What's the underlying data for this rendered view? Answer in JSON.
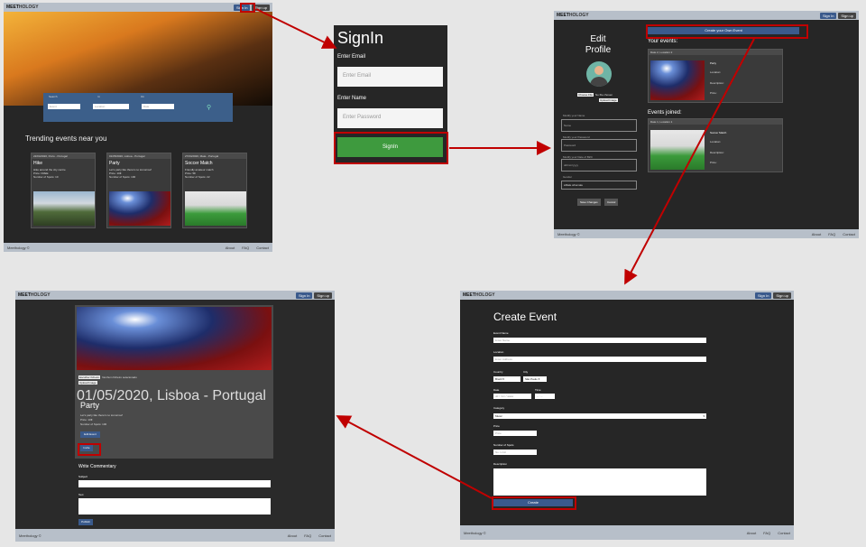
{
  "brand": {
    "logo_bold": "MEET",
    "logo_rest": "HOLOGY"
  },
  "nav": {
    "signin": "Sign In",
    "signup": "Sign up"
  },
  "footer": {
    "brand": "Meethology ©",
    "about": "About",
    "faq": "FAQ",
    "contact": "Contact"
  },
  "home": {
    "search_labels": [
      "Search",
      "In",
      "On"
    ],
    "search_placeholders": [
      "Event",
      "Location",
      "Date"
    ],
    "section_title": "Trending events near you",
    "cards": [
      {
        "date": "22/04/2020, Porto - Portugal",
        "title": "Hike",
        "desc": "Hike around the city centre",
        "price": "Price: FREE",
        "spots": "Number of Spots: 10"
      },
      {
        "date": "01/05/2020, Lisboa - Portugal",
        "title": "Party",
        "desc": "Let's party like there's no tomorrow!",
        "price": "Price: 10€",
        "spots": "Number of Spots: 100"
      },
      {
        "date": "27/04/2020, Maia - Portugal",
        "title": "Soccer Match",
        "desc": "Friendly amateur match",
        "price": "Price: 5€",
        "spots": "Number of Spots: 22"
      }
    ]
  },
  "signin": {
    "title": "SignIn",
    "email_label": "Enter Email",
    "email_placeholder": "Enter Email",
    "name_label": "Enter Name",
    "password_placeholder": "Enter Password",
    "button": "SignIn"
  },
  "profile": {
    "title_line1": "Edit",
    "title_line2": "Profile",
    "choose_file": "Choose File",
    "no_file": "No file chosen",
    "upload": "Upload Image",
    "fields": [
      {
        "label": "Modify your Name",
        "placeholder": "Name"
      },
      {
        "label": "Modify your Password",
        "placeholder": "Password"
      },
      {
        "label": "Modify your Date of Birth",
        "placeholder": "dd/mm/yyyy"
      }
    ],
    "gender_label": "Gender",
    "male": "Male",
    "female": "Female",
    "save": "Save Changes",
    "cancel": "Cancel",
    "create_button": "Create your Own Event",
    "your_events": "Your events:",
    "events_joined": "Events joined:",
    "event_header": "Date 1, Location 1",
    "event_header2": "Date 2, Location 2",
    "event_title": "Party",
    "event_title2": "Soccer Match",
    "fields_right": [
      "Location:",
      "Description:",
      "Price:"
    ]
  },
  "create": {
    "title": "Create Event",
    "event_name_label": "Event Name",
    "event_name_ph": "Enter Name",
    "location_label": "Location",
    "location_ph": "Enter Address",
    "country_label": "Country",
    "country_val": "Brazil",
    "city_label": "City",
    "city_val": "São Paulo",
    "date_label": "Date",
    "date_ph": "dd / mm / aaaa",
    "time_label": "Time",
    "time_ph": "-- : --",
    "category_label": "Category",
    "category_val": "Music",
    "price_label": "Price",
    "price_ph": "Price",
    "spots_label": "Number of Spots",
    "spots_ph": "No. Limit",
    "desc_label": "Description",
    "button": "Create"
  },
  "eventpage": {
    "choose_file": "Escolher ficheiro",
    "no_file": "Nenhum ficheiro selecionado",
    "upload": "Upload Image",
    "date": "01/05/2020, Lisboa - Portugal",
    "title": "Party",
    "desc": "Let's party like there's no tomorrow!",
    "price": "Price: 10€",
    "spots": "Number of Spots: 100",
    "edit": "Edit Event",
    "invite": "Invite",
    "commentary_title": "Write Commentary",
    "subject_label": "Subject",
    "text_label": "Text",
    "publish": "Publish"
  },
  "colors": {
    "highlight": "#c00000",
    "accent": "#3a5a8c",
    "panel": "#262626"
  }
}
